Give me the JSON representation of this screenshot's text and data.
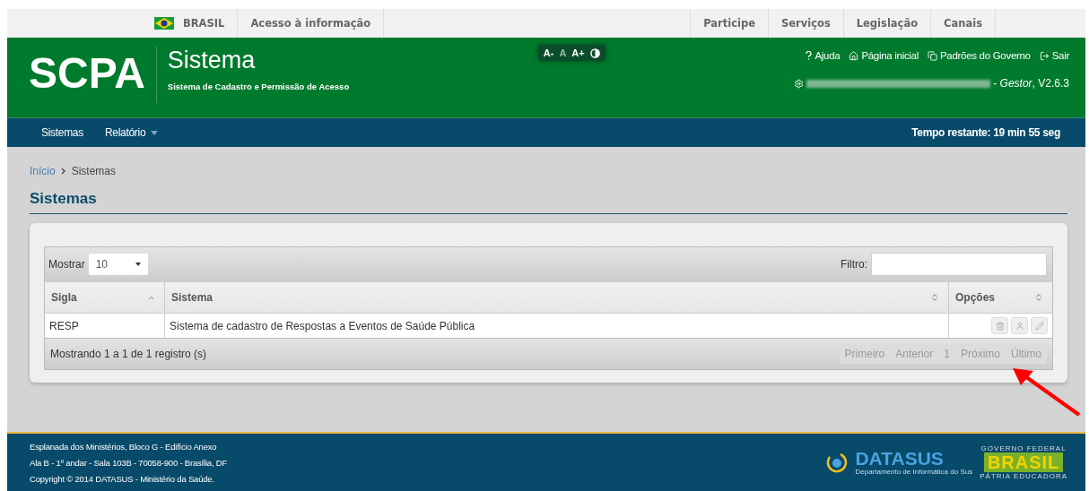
{
  "gov_bar": {
    "country": "BRASIL",
    "access": "Acesso à informação",
    "links": [
      "Participe",
      "Serviços",
      "Legislação",
      "Canais"
    ]
  },
  "header": {
    "logo": "SCPA",
    "title": "Sistema",
    "subtitle": "Sistema de Cadastro e Permissão de Acesso",
    "font_controls": [
      {
        "label": "A-",
        "selected": false
      },
      {
        "label": "A",
        "selected": true
      },
      {
        "label": "A+",
        "selected": false
      }
    ],
    "links": [
      {
        "kind": "help",
        "label": "Ajuda"
      },
      {
        "kind": "home",
        "label": "Página inicial"
      },
      {
        "kind": "docs",
        "label": "Padrões do Governo"
      },
      {
        "kind": "exit",
        "label": "Sair"
      }
    ],
    "user": {
      "separator": "-",
      "role": "Gestor",
      "version": ", V2.6.3"
    }
  },
  "nav": {
    "items": [
      {
        "label": "Sistemas",
        "dropdown": false
      },
      {
        "label": "Relatório",
        "dropdown": true
      }
    ],
    "timer": "Tempo restante: 19 min 55 seg"
  },
  "breadcrumb": [
    "Início",
    "Sistemas"
  ],
  "page_title": "Sistemas",
  "table": {
    "show_label": "Mostrar",
    "page_size": "10",
    "filter_label": "Filtro:",
    "columns": [
      {
        "label": "Sigla",
        "sorted": true
      },
      {
        "label": "Sistema",
        "sorted": false
      },
      {
        "label": "Opções",
        "sorted": false
      }
    ],
    "rows": [
      {
        "cells": [
          "RESP",
          "Sistema de cadastro de Respostas a Eventos de Saúde Pública"
        ],
        "actions": [
          {
            "kind": "delete",
            "disabled": true
          },
          {
            "kind": "user",
            "disabled": true
          },
          {
            "kind": "edit",
            "disabled": true
          }
        ]
      }
    ],
    "info": "Mostrando 1 a 1 de 1 registro (s)",
    "pagination": [
      {
        "label": "Primeiro",
        "disabled": true
      },
      {
        "label": "Anterior",
        "disabled": true
      },
      {
        "label": "1",
        "disabled": true
      },
      {
        "label": "Próximo",
        "disabled": true
      },
      {
        "label": "Último",
        "disabled": true
      }
    ]
  },
  "footer": {
    "lines": [
      "Esplanada dos Ministérios, Bloco G - Edifício Anexo",
      "Ala B - 1º andar - Sala 103B - 70058-900 - Brasília, DF",
      "Copyright © 2014 DATASUS - Ministério da Saúde."
    ],
    "datasus": {
      "name": "DATASUS",
      "tagline": "Departamento de Informática do Sus"
    },
    "gov": {
      "top": "GOVERNO FEDERAL",
      "name": "BRASIL",
      "bottom": "PÁTRIA EDUCADORA"
    }
  }
}
